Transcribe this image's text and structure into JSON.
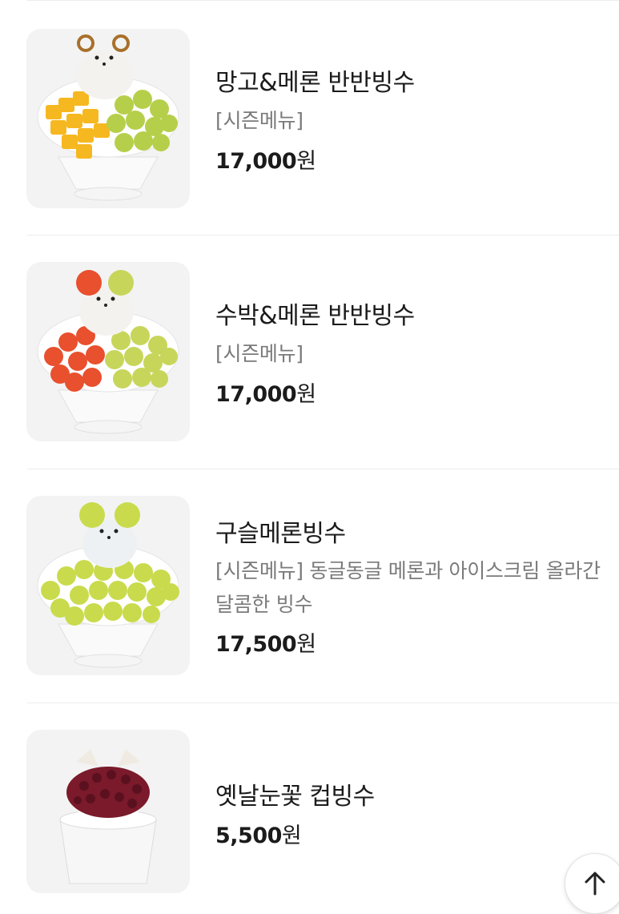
{
  "menu_items": [
    {
      "name": "망고&메론 반반빙수",
      "description": "[시즌메뉴]",
      "price": "17,000",
      "currency": "원"
    },
    {
      "name": "수박&메론 반반빙수",
      "description": "[시즌메뉴]",
      "price": "17,000",
      "currency": "원"
    },
    {
      "name": "구슬메론빙수",
      "description": "[시즌메뉴] 동글동글 메론과 아이스크림 올라간 달콤한 빙수",
      "price": "17,500",
      "currency": "원"
    },
    {
      "name": "옛날눈꽃 컵빙수",
      "price": "5,500",
      "currency": "원"
    }
  ],
  "scroll_top_button": {
    "icon": "arrow-up-icon"
  }
}
